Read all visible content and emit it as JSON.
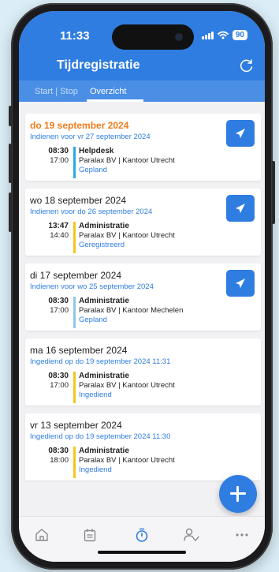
{
  "status_bar": {
    "time": "11:33",
    "battery": "90"
  },
  "header": {
    "title": "Tijdregistratie",
    "refresh_icon": "refresh-icon"
  },
  "tabs": [
    {
      "label": "Start | Stop",
      "active": false
    },
    {
      "label": "Overzicht",
      "active": true
    }
  ],
  "cards": [
    {
      "date": "do 19 september 2024",
      "highlight": true,
      "subtitle": "Indienen voor vr 27 september 2024",
      "has_send": true,
      "entry": {
        "start": "08:30",
        "end": "17:00",
        "title": "Helpdesk",
        "description": "Paralax BV | Kantoor Utrecht",
        "status": "Gepland",
        "bar_color": "#2aa7e6"
      }
    },
    {
      "date": "wo 18 september 2024",
      "highlight": false,
      "subtitle": "Indienen voor do 26 september 2024",
      "has_send": true,
      "entry": {
        "start": "13:47",
        "end": "14:40",
        "title": "Administratie",
        "description": "Paralax BV | Kantoor Utrecht",
        "status": "Geregistreerd",
        "bar_color": "#f5c51f"
      }
    },
    {
      "date": "di 17 september 2024",
      "highlight": false,
      "subtitle": "Indienen voor wo 25 september 2024",
      "has_send": true,
      "entry": {
        "start": "08:30",
        "end": "17:00",
        "title": "Administratie",
        "description": "Paralax BV | Kantoor Mechelen",
        "status": "Gepland",
        "bar_color": "#8ec7ea"
      }
    },
    {
      "date": "ma 16 september 2024",
      "highlight": false,
      "subtitle": "Ingediend op do 19 september 2024 11:31",
      "has_send": false,
      "entry": {
        "start": "08:30",
        "end": "17:00",
        "title": "Administratie",
        "description": "Paralax BV | Kantoor Utrecht",
        "status": "Ingediend",
        "bar_color": "#f5c51f"
      }
    },
    {
      "date": "vr 13 september 2024",
      "highlight": false,
      "subtitle": "Ingediend op do 19 september 2024 11:30",
      "has_send": false,
      "entry": {
        "start": "08:30",
        "end": "18:00",
        "title": "Administratie",
        "description": "Paralax BV | Kantoor Utrecht",
        "status": "Ingediend",
        "bar_color": "#f5c51f"
      }
    }
  ],
  "fab": {
    "icon": "plus-icon"
  },
  "bottom_nav": [
    {
      "icon": "home-icon",
      "active": false
    },
    {
      "icon": "calendar-icon",
      "active": false
    },
    {
      "icon": "stopwatch-icon",
      "active": true
    },
    {
      "icon": "person-check-icon",
      "active": false
    },
    {
      "icon": "more-icon",
      "active": false
    }
  ],
  "colors": {
    "primary": "#2f7de1",
    "highlight_date": "#f07c1a",
    "nav_inactive": "#8a8a8e"
  }
}
